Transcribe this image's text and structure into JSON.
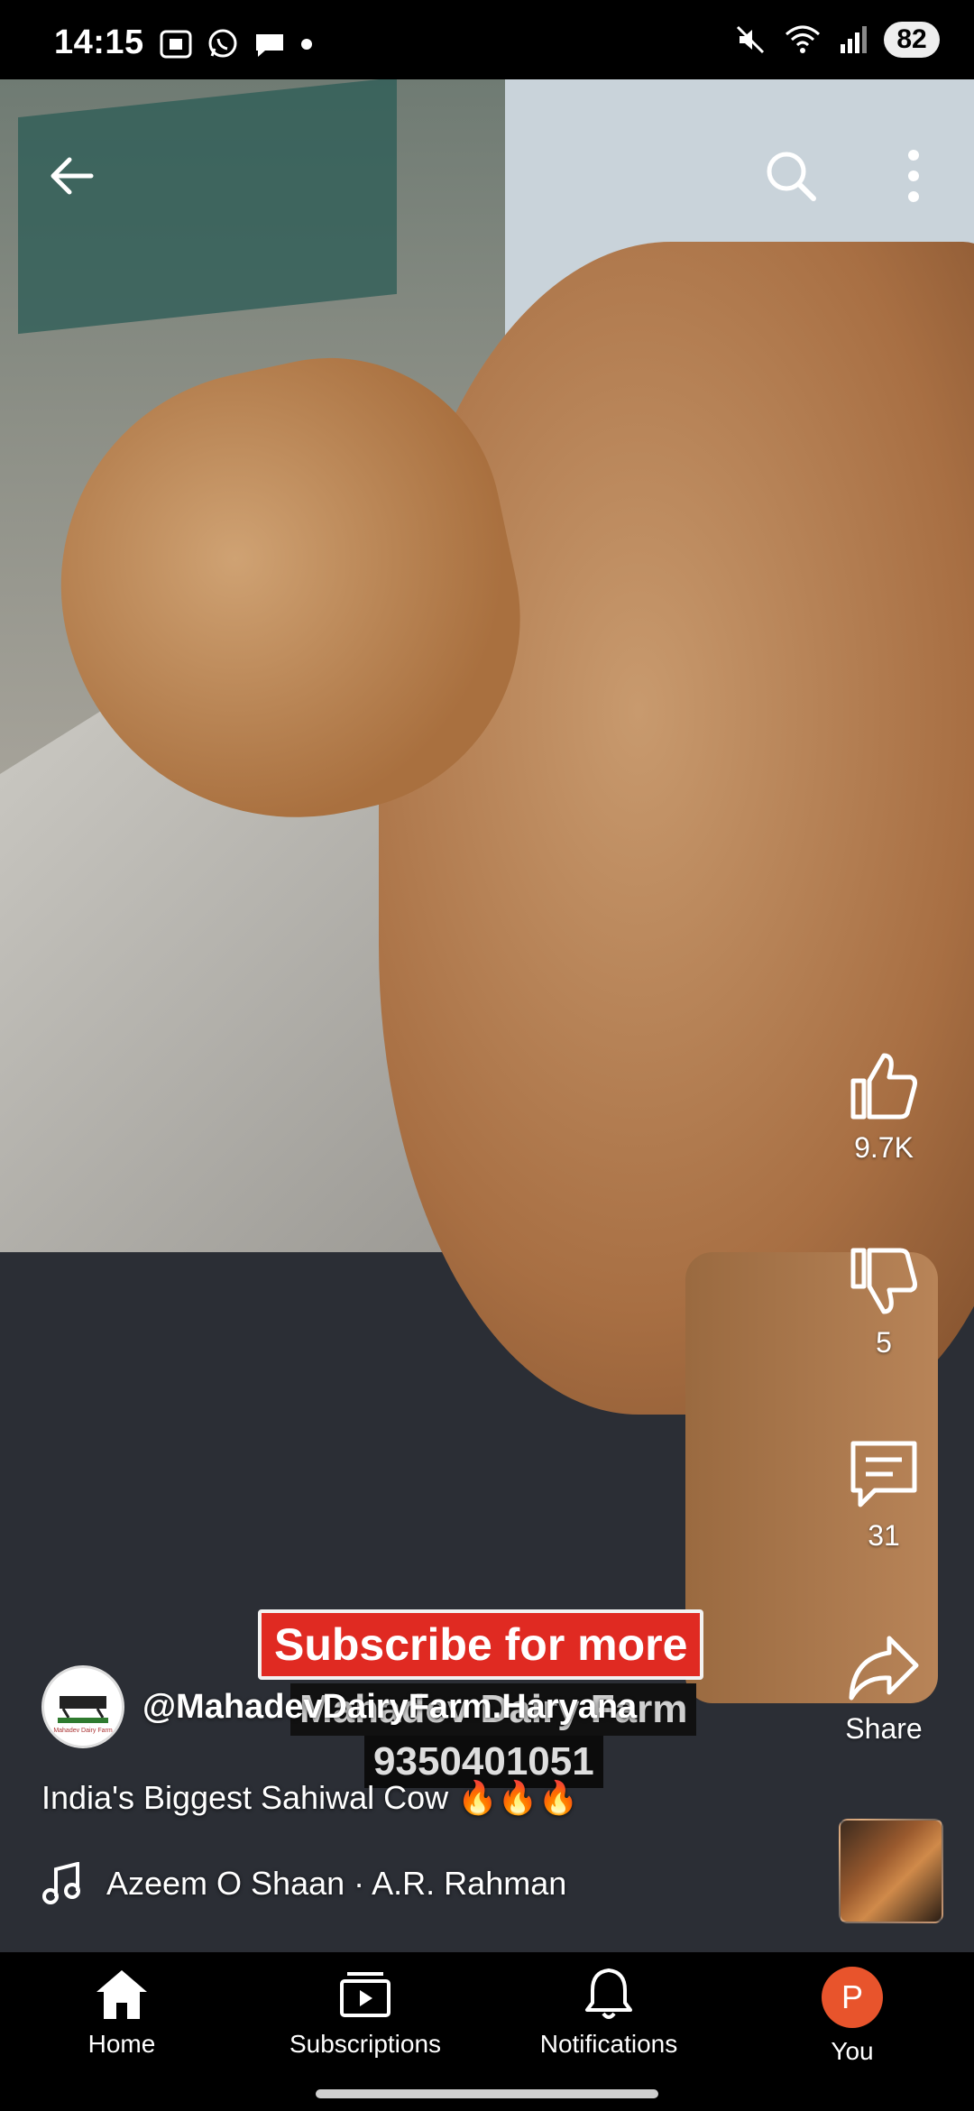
{
  "status_bar": {
    "time": "14:15",
    "battery": "82",
    "left_icons": [
      "screenshot-icon",
      "whatsapp-icon",
      "chat-bubble-icon",
      "dot-icon"
    ],
    "right_icons": [
      "mute-icon",
      "wifi-icon",
      "signal-icon"
    ]
  },
  "top_bar": {
    "icons": [
      "back-arrow-icon",
      "search-icon",
      "more-vert-icon"
    ]
  },
  "actions": {
    "likes": "9.7K",
    "dislikes": "5",
    "comments": "31",
    "share_label": "Share"
  },
  "overlays": {
    "subscribe": "Subscribe for more",
    "farm_name": "Mahadev Dairy Farm",
    "phone": "9350401051"
  },
  "channel": {
    "handle": "@MahadevDairyFarm.Haryana",
    "avatar_text": "Mahadev Dairy Farm"
  },
  "video": {
    "title": "India's Biggest Sahiwal Cow 🔥🔥🔥",
    "music": "Azeem O Shaan · A.R. Rahman"
  },
  "bottom_nav": {
    "items": [
      {
        "label": "Home",
        "icon": "home-icon"
      },
      {
        "label": "Subscriptions",
        "icon": "subscriptions-icon"
      },
      {
        "label": "Notifications",
        "icon": "bell-icon"
      },
      {
        "label": "You",
        "icon": "avatar-icon",
        "avatar_letter": "P"
      }
    ]
  },
  "colors": {
    "subscribe_red": "#e02a22",
    "you_avatar": "#e8542c"
  }
}
